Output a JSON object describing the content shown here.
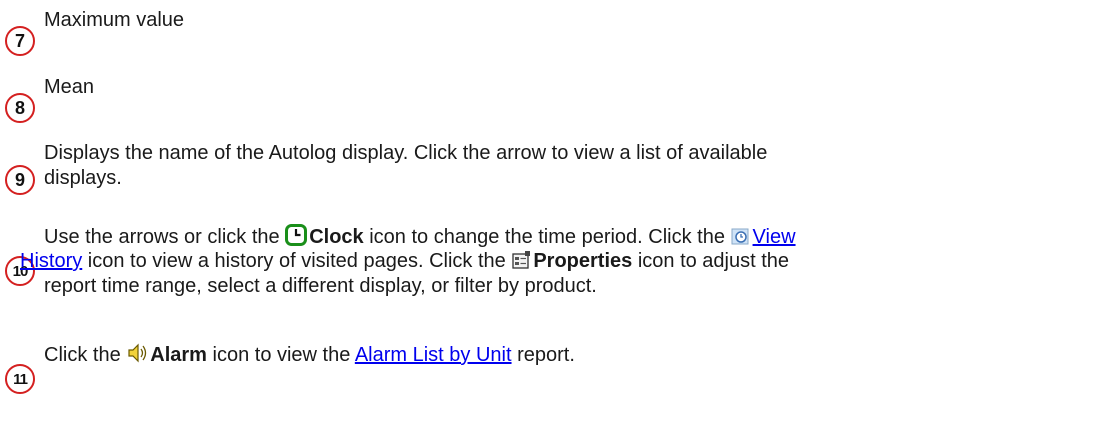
{
  "items": [
    {
      "number": "7",
      "text": "Maximum value"
    },
    {
      "number": "8",
      "text": "Mean"
    },
    {
      "number": "9",
      "line1": "Displays the name of the Autolog display. Click the arrow to view  a list of available",
      "line2": "displays."
    },
    {
      "number": "10",
      "seg_use": "Use the arrows or click the ",
      "clock_label": "Clock",
      "seg_change": " icon to change the time period. Click the ",
      "view_link_part1": "View",
      "view_link_part2": "History",
      "seg_history": " icon to view a history of visited pages. Click the ",
      "properties_label": "Properties",
      "seg_adjust": " icon to adjust the",
      "line3": "report time range, select a different display, or filter by product."
    },
    {
      "number": "11",
      "seg_click": "Click the ",
      "alarm_label": "Alarm",
      "seg_view": " icon to view the ",
      "alarm_link": "Alarm List by Unit",
      "seg_report": " report."
    }
  ],
  "icons": {
    "clock": "clock-icon",
    "view_history": "view-history-icon",
    "properties": "properties-icon",
    "alarm": "alarm-icon"
  },
  "colors": {
    "badge_border": "#d42020",
    "link": "#0000ee"
  }
}
